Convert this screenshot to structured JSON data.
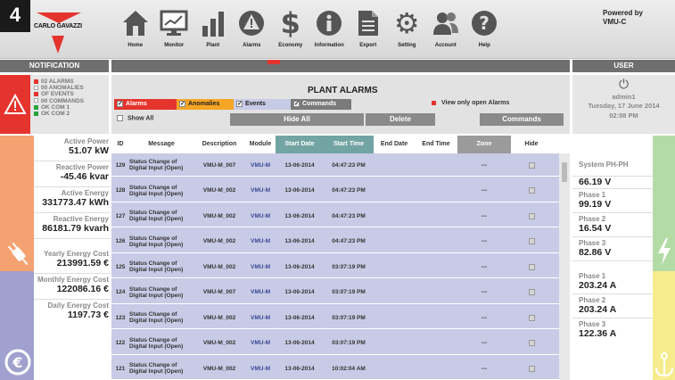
{
  "badge": "4",
  "brand": {
    "name": "CARLO GAVAZZI",
    "powered_by": "Powered by",
    "product": "VMU-C"
  },
  "nav": [
    {
      "label": "Home",
      "icon": "home-icon"
    },
    {
      "label": "Monitor",
      "icon": "monitor-icon"
    },
    {
      "label": "Plant",
      "icon": "bar-chart-icon"
    },
    {
      "label": "Alarms",
      "icon": "alarm-icon"
    },
    {
      "label": "Economy",
      "icon": "dollar-icon"
    },
    {
      "label": "Information",
      "icon": "info-icon"
    },
    {
      "label": "Export",
      "icon": "document-icon"
    },
    {
      "label": "Setting",
      "icon": "gear-icon"
    },
    {
      "label": "Account",
      "icon": "users-icon"
    },
    {
      "label": "Help",
      "icon": "help-icon"
    }
  ],
  "headers": {
    "notification": "NOTIFICATION",
    "user": "USER"
  },
  "notifications": [
    {
      "text": "02  ALARMS",
      "status": "red"
    },
    {
      "text": "00  ANOMALIES",
      "status": "grey"
    },
    {
      "text": "OF  EVENTS",
      "status": "red"
    },
    {
      "text": "00  COMMANDS",
      "status": "grey"
    },
    {
      "text": "OK  COM 1",
      "status": "green"
    },
    {
      "text": "OK  COM 2",
      "status": "green"
    }
  ],
  "metrics": [
    {
      "label": "Active Power",
      "value": "51.07 kW"
    },
    {
      "label": "Reactive Power",
      "value": "-45.46 kvar"
    },
    {
      "label": "Active Energy",
      "value": "331773.47 kWh"
    },
    {
      "label": "Reactive Energy",
      "value": "86181.79 kvarh"
    },
    {
      "label": "Yearly Energy Cost",
      "value": "213991.59 €"
    },
    {
      "label": "Monthly Energy Cost",
      "value": "122086.16 €"
    },
    {
      "label": "Daily Energy Cost",
      "value": "1197.73 €"
    }
  ],
  "plant": {
    "title": "PLANT ALARMS",
    "filters": [
      {
        "label": "Alarms",
        "checked": true,
        "color": "#e5342d",
        "text_color": "#ffffff"
      },
      {
        "label": "Anomalies",
        "checked": true,
        "color": "#f6a524",
        "text_color": "#222222"
      },
      {
        "label": "Events",
        "checked": true,
        "color": "#c8cbe6",
        "text_color": "#222222"
      },
      {
        "label": "Commands",
        "checked": true,
        "color": "#7a7a7a",
        "text_color": "#ffffff"
      }
    ],
    "view_only_open": "View only open Alarms",
    "show_all": "Show All",
    "buttons": {
      "hide_all": "Hide All",
      "delete": "Delete",
      "commands": "Commands"
    }
  },
  "table": {
    "columns": [
      "ID",
      "Message",
      "Description",
      "Module",
      "Start Date",
      "Start Time",
      "End Date",
      "End Time",
      "Zone",
      "Hide"
    ],
    "rows": [
      {
        "id": "129",
        "message": "Status Change of Digital Input (Open)",
        "description": "VMU-M_007",
        "module": "VMU-M",
        "start_date": "13-06-2014",
        "start_time": "04:47:23 PM",
        "end_date": "",
        "end_time": "",
        "zone": "---"
      },
      {
        "id": "128",
        "message": "Status Change of Digital Input (Open)",
        "description": "VMU-M_002",
        "module": "VMU-M",
        "start_date": "13-06-2014",
        "start_time": "04:47:23 PM",
        "end_date": "",
        "end_time": "",
        "zone": "---"
      },
      {
        "id": "127",
        "message": "Status Change of Digital Input (Open)",
        "description": "VMU-M_002",
        "module": "VMU-M",
        "start_date": "13-06-2014",
        "start_time": "04:47:23 PM",
        "end_date": "",
        "end_time": "",
        "zone": "---"
      },
      {
        "id": "126",
        "message": "Status Change of Digital Input (Open)",
        "description": "VMU-M_002",
        "module": "VMU-M",
        "start_date": "13-06-2014",
        "start_time": "04:47:23 PM",
        "end_date": "",
        "end_time": "",
        "zone": "---"
      },
      {
        "id": "125",
        "message": "Status Change of Digital Input (Open)",
        "description": "VMU-M_002",
        "module": "VMU-M",
        "start_date": "13-06-2014",
        "start_time": "03:07:19 PM",
        "end_date": "",
        "end_time": "",
        "zone": "---"
      },
      {
        "id": "124",
        "message": "Status Change of Digital Input (Open)",
        "description": "VMU-M_007",
        "module": "VMU-M",
        "start_date": "13-06-2014",
        "start_time": "03:07:19 PM",
        "end_date": "",
        "end_time": "",
        "zone": "---"
      },
      {
        "id": "123",
        "message": "Status Change of Digital Input (Open)",
        "description": "VMU-M_002",
        "module": "VMU-M",
        "start_date": "13-06-2014",
        "start_time": "03:07:19 PM",
        "end_date": "",
        "end_time": "",
        "zone": "---"
      },
      {
        "id": "122",
        "message": "Status Change of Digital Input (Open)",
        "description": "VMU-M_002",
        "module": "VMU-M",
        "start_date": "13-06-2014",
        "start_time": "03:07:19 PM",
        "end_date": "",
        "end_time": "",
        "zone": "---"
      },
      {
        "id": "121",
        "message": "Status Change of Digital Input (Open)",
        "description": "VMU-M_002",
        "module": "VMU-M",
        "start_date": "13-06-2014",
        "start_time": "10:02:04 AM",
        "end_date": "",
        "end_time": "",
        "zone": "---"
      }
    ]
  },
  "user": {
    "name": "admin1",
    "date": "Tuesday, 17 June 2014",
    "time": "02:08 PM"
  },
  "system": [
    {
      "label": "System PH-PH",
      "value": "66.19 V"
    },
    {
      "label": "Phase 1",
      "value": "99.19 V"
    },
    {
      "label": "Phase 2",
      "value": "16.54 V"
    },
    {
      "label": "Phase 3",
      "value": "82.86 V"
    },
    {
      "label": "Phase 1",
      "value": "203.24 A"
    },
    {
      "label": "Phase 2",
      "value": "203.24 A"
    },
    {
      "label": "Phase 3",
      "value": "122.36 A"
    }
  ]
}
